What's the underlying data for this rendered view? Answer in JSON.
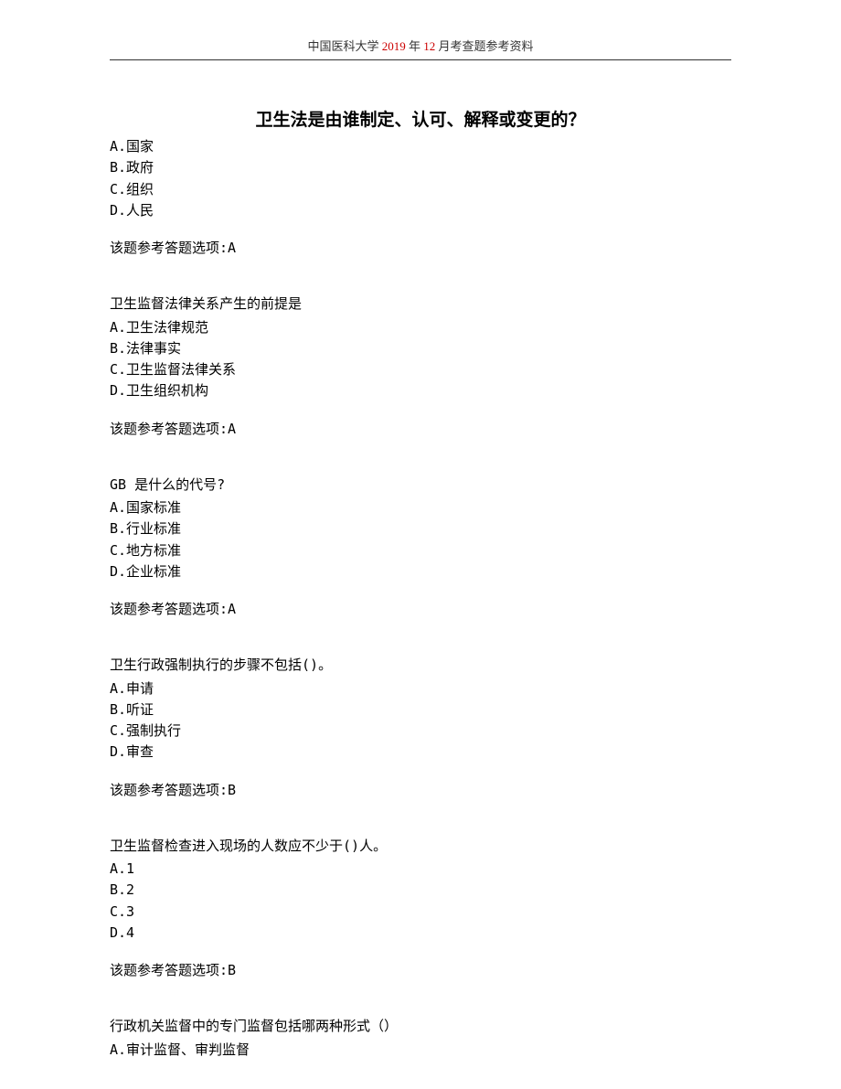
{
  "header": {
    "prefix": "中国医科大学",
    "year": " 2019 ",
    "mid": "年",
    "month": " 12 ",
    "suffix": "月考查题参考资料"
  },
  "title": "卫生法是由谁制定、认可、解释或变更的？",
  "questions": [
    {
      "stem": "",
      "options": [
        "A.国家",
        "B.政府",
        "C.组织",
        "D.人民"
      ],
      "answer": "该题参考答题选项:A"
    },
    {
      "stem": "卫生监督法律关系产生的前提是",
      "options": [
        "A.卫生法律规范",
        "B.法律事实",
        "C.卫生监督法律关系",
        "D.卫生组织机构"
      ],
      "answer": "该题参考答题选项:A"
    },
    {
      "stem": "GB 是什么的代号?",
      "options": [
        "A.国家标准",
        "B.行业标准",
        "C.地方标准",
        "D.企业标准"
      ],
      "answer": "该题参考答题选项:A"
    },
    {
      "stem": "卫生行政强制执行的步骤不包括()。",
      "options": [
        "A.申请",
        "B.听证",
        "C.强制执行",
        "D.审查"
      ],
      "answer": "该题参考答题选项:B"
    },
    {
      "stem": "卫生监督检查进入现场的人数应不少于()人。",
      "options": [
        "A.1",
        "B.2",
        "C.3",
        "D.4"
      ],
      "answer": "该题参考答题选项:B"
    },
    {
      "stem": "行政机关监督中的专门监督包括哪两种形式（）",
      "options": [
        "A.审计监督、审判监督"
      ],
      "answer": ""
    }
  ]
}
